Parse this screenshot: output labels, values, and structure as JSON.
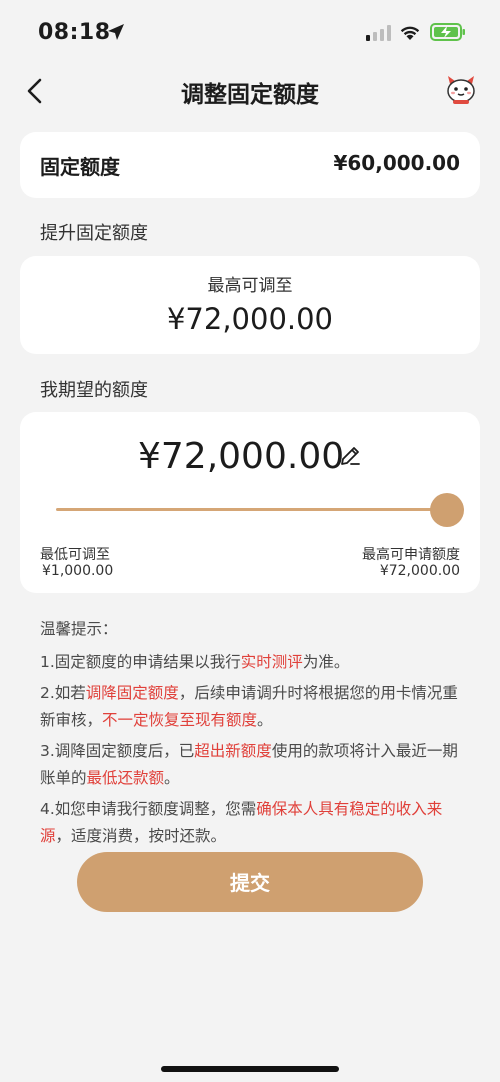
{
  "status_bar": {
    "time": "08:18"
  },
  "nav": {
    "title": "调整固定额度"
  },
  "fixed_limit": {
    "label": "固定额度",
    "value": "¥60,000.00"
  },
  "raise_section": {
    "title": "提升固定额度",
    "max_label": "最高可调至",
    "max_value": "¥72,000.00"
  },
  "expect_section": {
    "title": "我期望的额度",
    "amount": "¥72,000.00",
    "slider_fraction": 1.0,
    "min_label": "最低可调至",
    "min_value": "¥1,000.00",
    "max_label": "最高可申请额度",
    "max_value": "¥72,000.00"
  },
  "tips": {
    "title": "温馨提示：",
    "t1_a": "1.固定额度的申请结果以我行",
    "t1_red": "实时测评",
    "t1_b": "为准。",
    "t2_a": "2.如若",
    "t2_red1": "调降固定额度",
    "t2_b": "，后续申请调升时将根据您的用卡情况重新审核，",
    "t2_red2": "不一定恢复至现有额度",
    "t2_c": "。",
    "t3_a": "3.调降固定额度后，已",
    "t3_red1": "超出新额度",
    "t3_b": "使用的款项将计入最近一期账单的",
    "t3_red2": "最低还款额",
    "t3_c": "。",
    "t4_a": "4.如您申请我行额度调整，您需",
    "t4_red": "确保本人具有稳定的收入来源",
    "t4_b": "，适度消费，按时还款。"
  },
  "submit": {
    "label": "提交"
  },
  "colors": {
    "accent": "#cfa070",
    "warning_red": "#e0403a",
    "background": "#f3f3f3"
  },
  "icons": [
    "location-arrow-icon",
    "signal-icon",
    "wifi-icon",
    "battery-charging-icon",
    "back-icon",
    "mascot-icon",
    "pencil-icon"
  ]
}
